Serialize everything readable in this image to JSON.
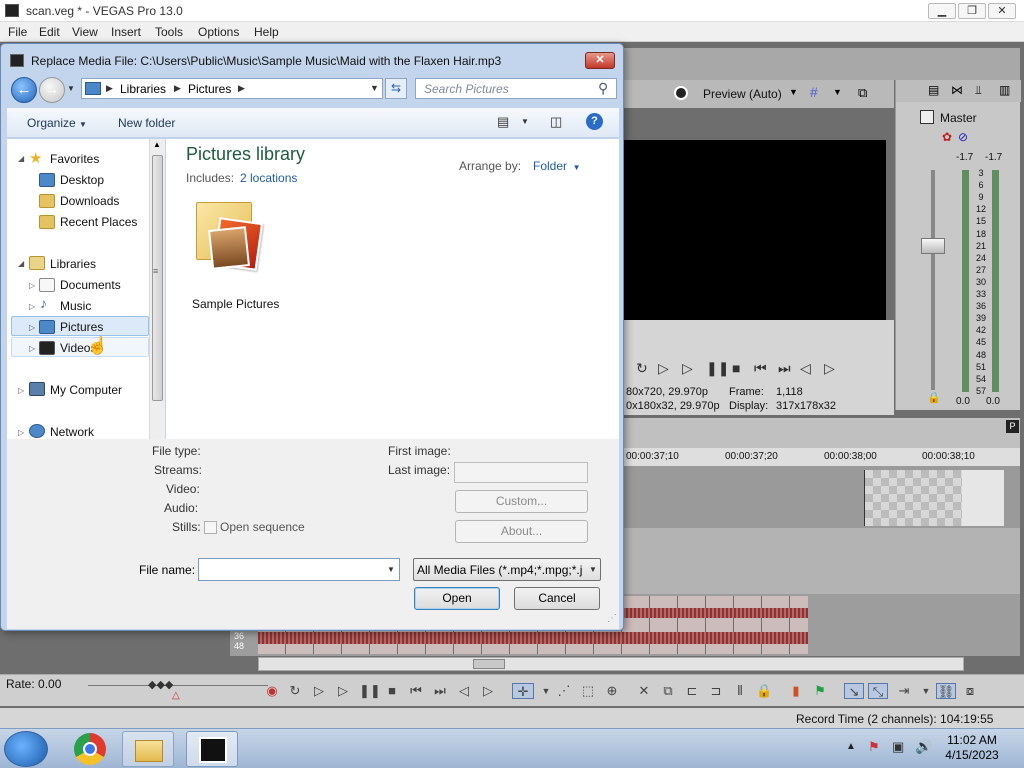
{
  "app": {
    "window_title": "scan.veg * - VEGAS Pro 13.0",
    "menu": [
      "File",
      "Edit",
      "View",
      "Insert",
      "Tools",
      "Options",
      "Help"
    ]
  },
  "vegas": {
    "preview_label": "Preview (Auto)",
    "project_info": "80x720, 29.970p",
    "preview_info": "0x180x32, 29.970p",
    "frame_label": "Frame:",
    "frame_value": "1,118",
    "display_label": "Display:",
    "display_value": "317x178x32",
    "master_label": "Master",
    "meter_peak_left": "-1.7",
    "meter_peak_right": "-1.7",
    "meter_scale": [
      "3",
      "6",
      "9",
      "12",
      "15",
      "18",
      "21",
      "24",
      "27",
      "30",
      "33",
      "36",
      "39",
      "42",
      "45",
      "48",
      "51",
      "54",
      "57"
    ],
    "meter_bottom_left": "0.0",
    "meter_bottom_right": "0.0",
    "timecodes": [
      "00:00:37;10",
      "00:00:37;20",
      "00:00:38;00",
      "00:00:38;10"
    ],
    "track_numbers": [
      "36",
      "48"
    ],
    "rate_label": "Rate: 0.00",
    "record_time": "Record Time (2 channels): 104:19:55"
  },
  "taskbar": {
    "time": "11:02 AM",
    "date": "4/15/2023"
  },
  "dialog": {
    "title": "Replace Media File: C:\\Users\\Public\\Music\\Sample Music\\Maid with the Flaxen Hair.mp3",
    "close_label": "✕",
    "breadcrumb": [
      "Libraries",
      "Pictures"
    ],
    "search_placeholder": "Search Pictures",
    "organize_label": "Organize",
    "new_folder_label": "New folder",
    "nav": {
      "favorites": "Favorites",
      "desktop": "Desktop",
      "downloads": "Downloads",
      "recent_places": "Recent Places",
      "libraries": "Libraries",
      "documents": "Documents",
      "music": "Music",
      "pictures": "Pictures",
      "videos": "Videos",
      "my_computer": "My Computer",
      "network": "Network"
    },
    "library_title": "Pictures library",
    "includes_label": "Includes:",
    "includes_link": "2 locations",
    "arrange_label": "Arrange by:",
    "arrange_value": "Folder",
    "folder_name": "Sample Pictures",
    "details": {
      "file_type": "File type:",
      "streams": "Streams:",
      "video": "Video:",
      "audio": "Audio:",
      "stills": "Stills:",
      "open_sequence": "Open sequence",
      "first_image": "First image:",
      "last_image": "Last image:",
      "custom_button": "Custom...",
      "about_button": "About...",
      "file_name_label": "File name:",
      "file_name_value": "",
      "filter_value": "All Media Files (*.mp4;*.mpg;*.j",
      "open_button": "Open",
      "cancel_button": "Cancel"
    }
  }
}
